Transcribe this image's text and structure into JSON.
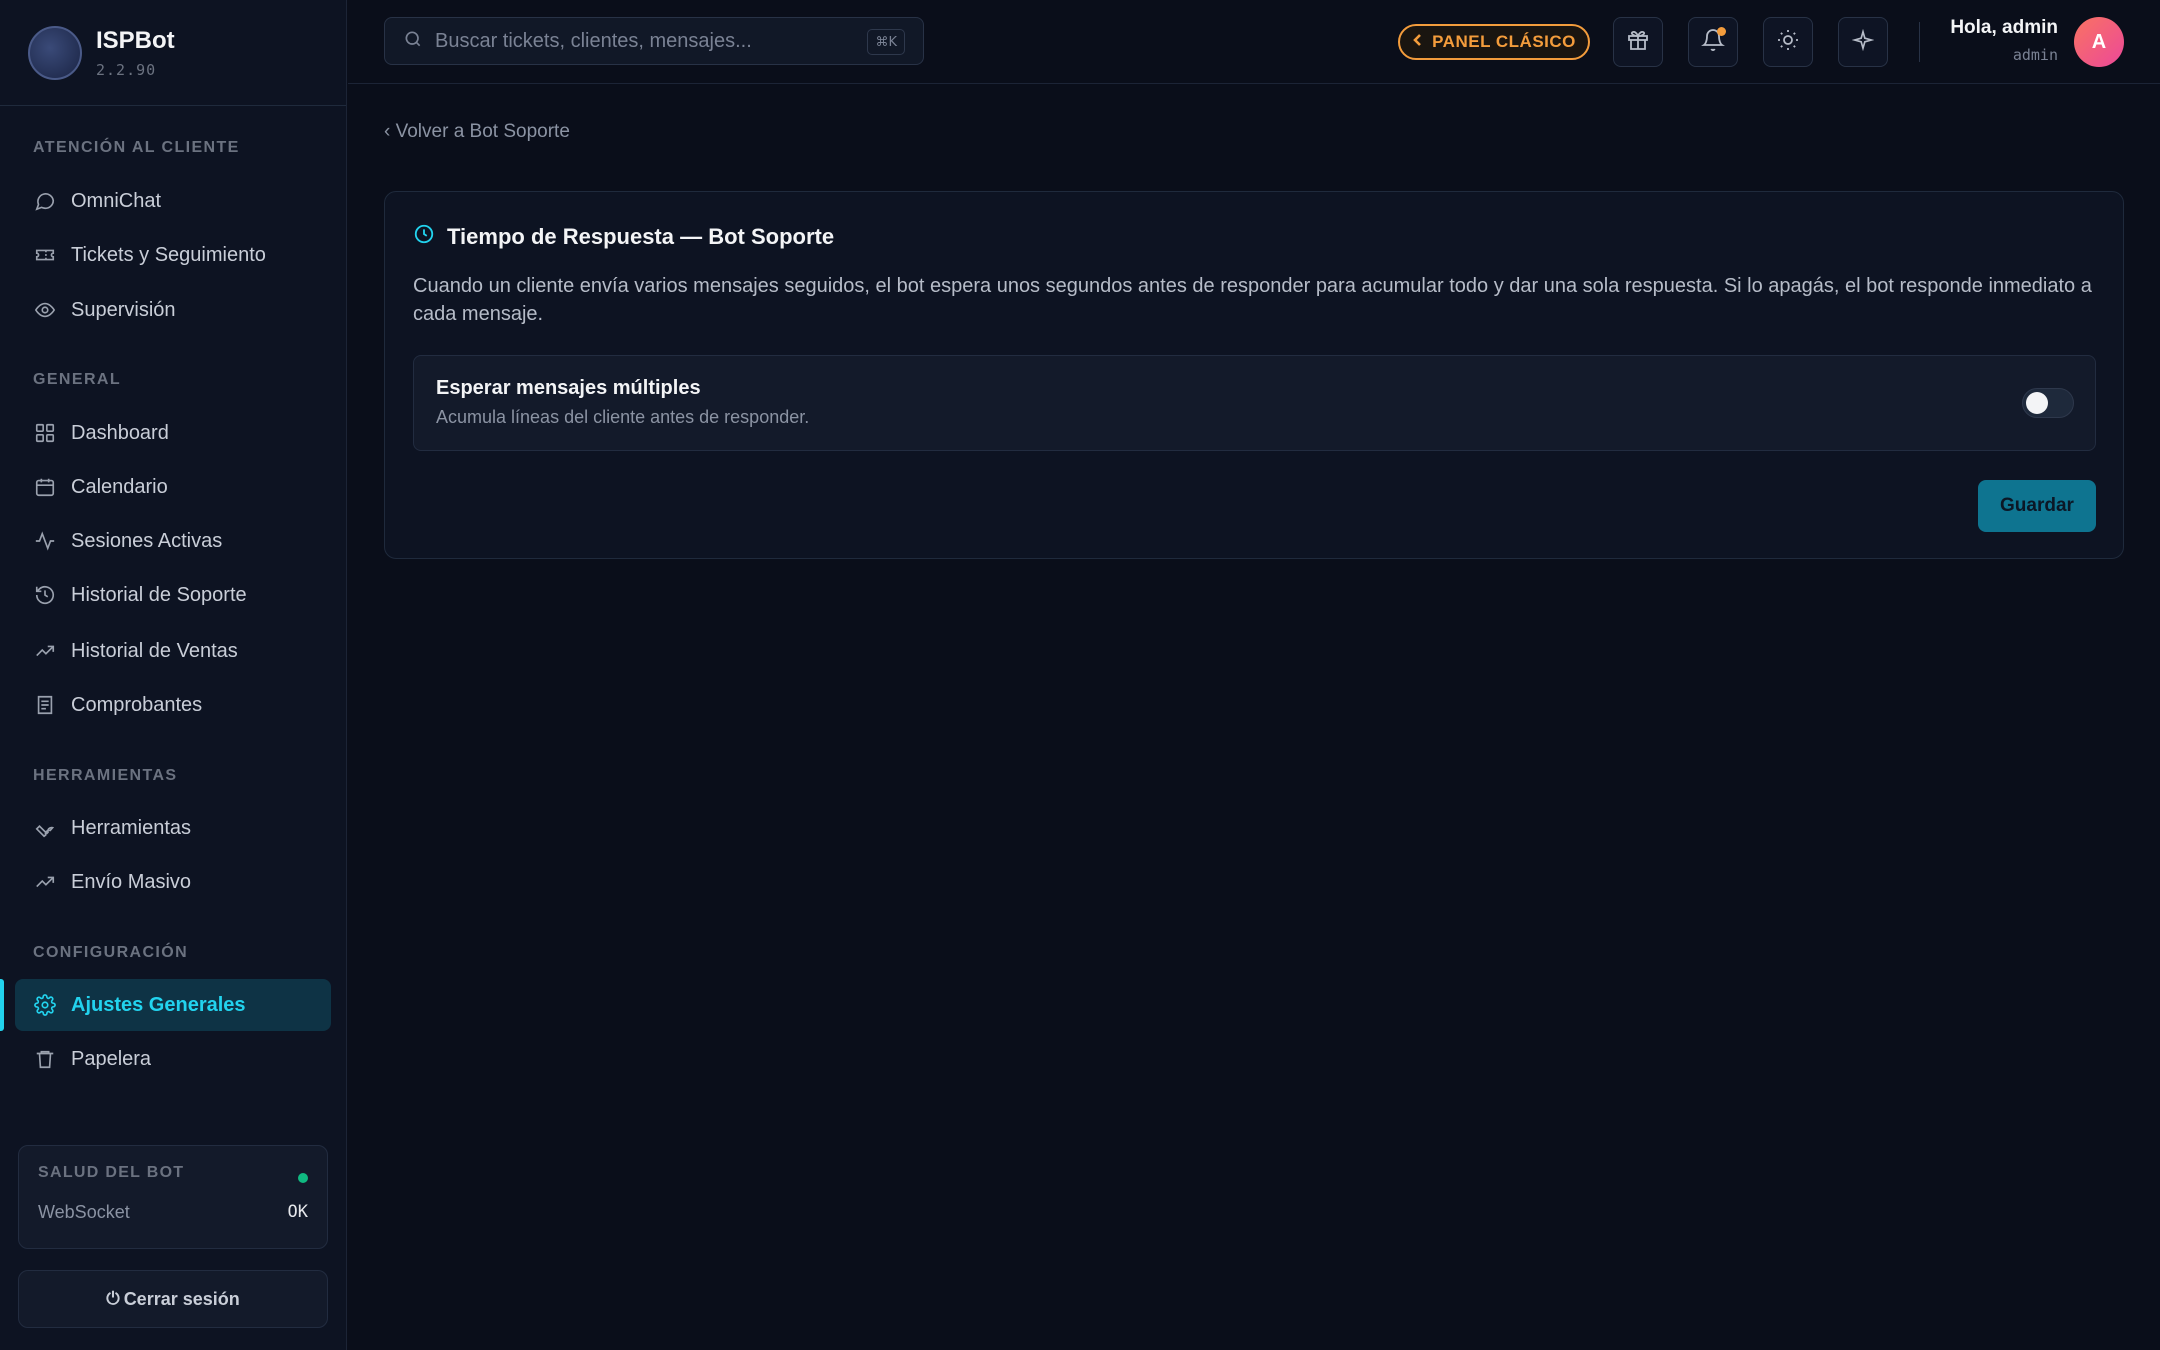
{
  "brand": {
    "name": "ISPBot",
    "version": "2.2.90",
    "logo_text": "ISPBot"
  },
  "sidebar": {
    "sections": {
      "atencion": "ATENCIÓN AL CLIENTE",
      "general": "GENERAL",
      "herramientas": "HERRAMIENTAS",
      "configuracion": "CONFIGURACIÓN"
    },
    "items": {
      "omnichat": "OmniChat",
      "tickets": "Tickets y Seguimiento",
      "supervision": "Supervisión",
      "dashboard": "Dashboard",
      "calendario": "Calendario",
      "sesiones": "Sesiones Activas",
      "historial_soporte": "Historial de Soporte",
      "historial_ventas": "Historial de Ventas",
      "comprobantes": "Comprobantes",
      "herramientas": "Herramientas",
      "envio_masivo": "Envío Masivo",
      "ajustes": "Ajustes Generales",
      "papelera": "Papelera"
    },
    "active_item": "ajustes",
    "health": {
      "title": "SALUD DEL BOT",
      "label": "WebSocket",
      "value": "OK",
      "status_color": "#10b981"
    },
    "logout": "Cerrar sesión"
  },
  "topbar": {
    "search_placeholder": "Buscar tickets, clientes, mensajes...",
    "search_shortcut": "⌘K",
    "classic_panel": "PANEL CLÁSICO",
    "greeting": "Hola, admin",
    "role": "admin",
    "avatar_initial": "A"
  },
  "content": {
    "back_link": "‹ Volver a Bot Soporte",
    "card": {
      "title": "Tiempo de Respuesta — Bot Soporte",
      "description": "Cuando un cliente envía varios mensajes seguidos, el bot espera unos segundos antes de responder para acumular todo y dar una sola respuesta. Si lo apagás, el bot responde inmediato a cada mensaje.",
      "option_title": "Esperar mensajes múltiples",
      "option_subtitle": "Acumula líneas del cliente antes de responder.",
      "toggle_on": false,
      "save_label": "Guardar"
    }
  },
  "colors": {
    "accent": "#22d3ee",
    "orange": "#f39c3c",
    "background": "#0a0e1a"
  }
}
